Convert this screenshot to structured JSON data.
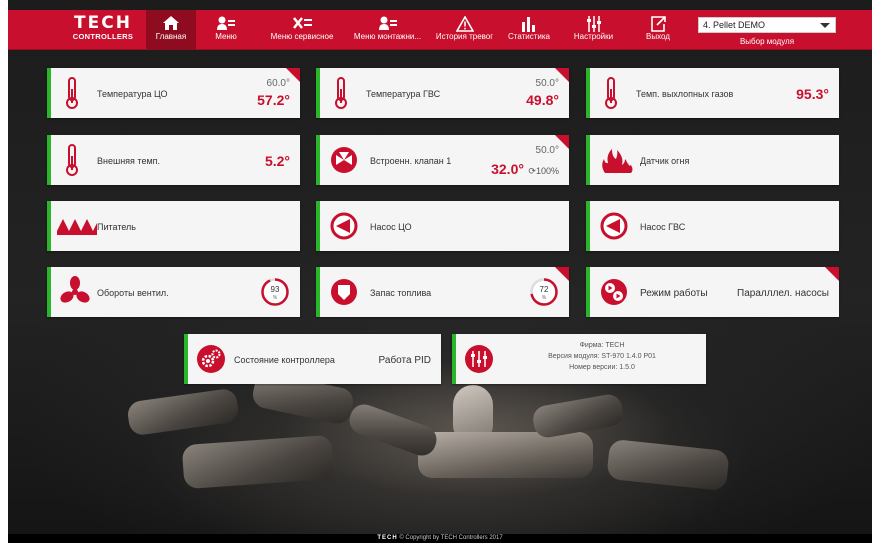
{
  "brand": {
    "line1": "TECH",
    "line2": "CONTROLLERS"
  },
  "nav": [
    {
      "label": "Главная",
      "icon": "home-icon"
    },
    {
      "label": "Меню",
      "icon": "menu-user-icon"
    },
    {
      "label": "Меню сервисное",
      "icon": "service-tools-icon"
    },
    {
      "label": "Меню монтажни...",
      "icon": "installer-menu-icon"
    },
    {
      "label": "История тревог",
      "icon": "alarm-warning-icon"
    },
    {
      "label": "Статистика",
      "icon": "statistics-bars-icon"
    },
    {
      "label": "Настройки",
      "icon": "settings-sliders-icon"
    },
    {
      "label": "Выход",
      "icon": "logout-icon"
    }
  ],
  "module_select": {
    "value": "4. Pellet DEMO",
    "caption": "Выбор модуля"
  },
  "tiles": {
    "co_temp": {
      "name": "Температура ЦО",
      "set": "60.0°",
      "value": "57.2°",
      "icon": "thermometer-icon"
    },
    "gvs_temp": {
      "name": "Температура ГВС",
      "set": "50.0°",
      "value": "49.8°",
      "icon": "thermometer-icon"
    },
    "exhaust": {
      "name": "Темп. выхлопных газов",
      "value": "95.3°",
      "icon": "thermometer-icon"
    },
    "outside": {
      "name": "Внешняя темп.",
      "value": "5.2°",
      "icon": "thermometer-icon"
    },
    "valve": {
      "name": "Встроенн. клапан 1",
      "set": "50.0°",
      "value": "32.0°",
      "opening": "100%",
      "icon": "valve-icon"
    },
    "fire": {
      "name": "Датчик огня",
      "icon": "fire-icon"
    },
    "feeder": {
      "name": "Питатель",
      "icon": "feeder-icon"
    },
    "pump_co": {
      "name": "Насос ЦО",
      "icon": "pump-icon"
    },
    "pump_gvs": {
      "name": "Насос ГВС",
      "icon": "pump-icon"
    },
    "fan": {
      "name": "Обороты вентил.",
      "ring_value": "93",
      "ring_unit": "%",
      "ring_level": 0.93,
      "icon": "fan-icon"
    },
    "fuel": {
      "name": "Запас топлива",
      "ring_value": "72",
      "ring_unit": "%",
      "ring_level": 0.72,
      "icon": "fuel-tank-icon"
    },
    "mode": {
      "name": "Режим работы",
      "value": "Паралллел. насосы",
      "icon": "operation-mode-icon"
    },
    "controller": {
      "name": "Состояние контроллера",
      "value": "Работа PID",
      "icon": "gears-icon"
    },
    "info": {
      "firm": "Фирма: TECH",
      "module_version": "Версия модуля: ST-970 1.4.0 P01",
      "version_number": "Номер версии: 1.5.0",
      "icon": "info-sliders-icon"
    }
  },
  "footer": {
    "brand": "TECH",
    "text": "© Copyright by TECH Controllers 2017"
  },
  "colors": {
    "accent": "#c8102e",
    "active_nav": "#8e0b20",
    "tile_border": "#2bb52a",
    "tile_bg": "#f5f5f5"
  }
}
